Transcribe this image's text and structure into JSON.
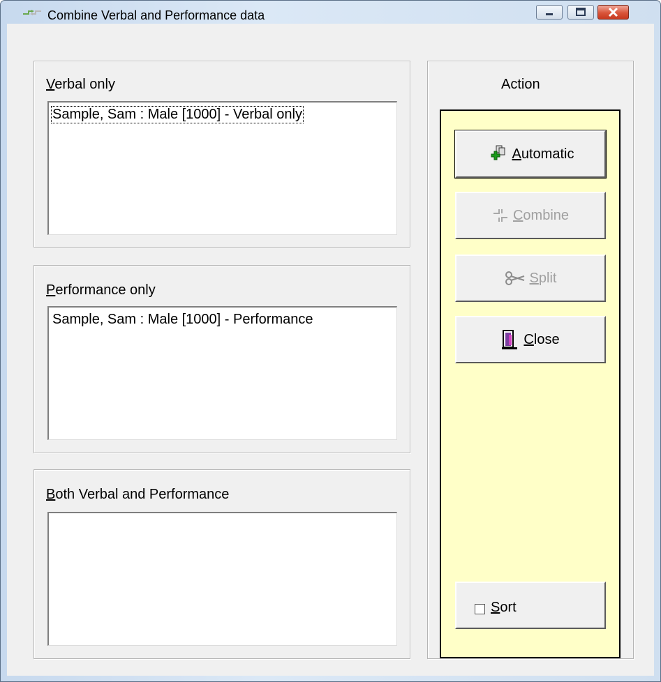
{
  "window": {
    "title": "Combine Verbal and Performance data",
    "icon": "combine-app-icon"
  },
  "groups": {
    "verbal": {
      "label_accel": "V",
      "label_rest": "erbal only",
      "items": [
        "Sample, Sam : Male [1000] - Verbal only"
      ]
    },
    "performance": {
      "label_accel": "P",
      "label_rest": "erformance only",
      "items": [
        "Sample, Sam : Male [1000] - Performance"
      ]
    },
    "both": {
      "label_accel": "B",
      "label_rest": "oth Verbal and Performance",
      "items": []
    }
  },
  "action": {
    "label": "Action",
    "buttons": {
      "automatic": {
        "accel": "A",
        "rest": "utomatic",
        "icon": "automatic-icon",
        "enabled": true
      },
      "combine": {
        "accel": "C",
        "rest": "ombine",
        "icon": "combine-icon",
        "enabled": false
      },
      "split": {
        "accel": "S",
        "rest": "plit",
        "icon": "scissors-icon",
        "enabled": false
      },
      "close": {
        "accel": "C",
        "rest": "lose",
        "icon": "door-exit-icon",
        "enabled": true
      }
    },
    "sort": {
      "accel": "S",
      "rest": "ort",
      "checked": false
    }
  },
  "colors": {
    "action_panel_bg": "#ffffc8",
    "client_bg": "#f0f0f0",
    "close_button": "#c7391f"
  }
}
